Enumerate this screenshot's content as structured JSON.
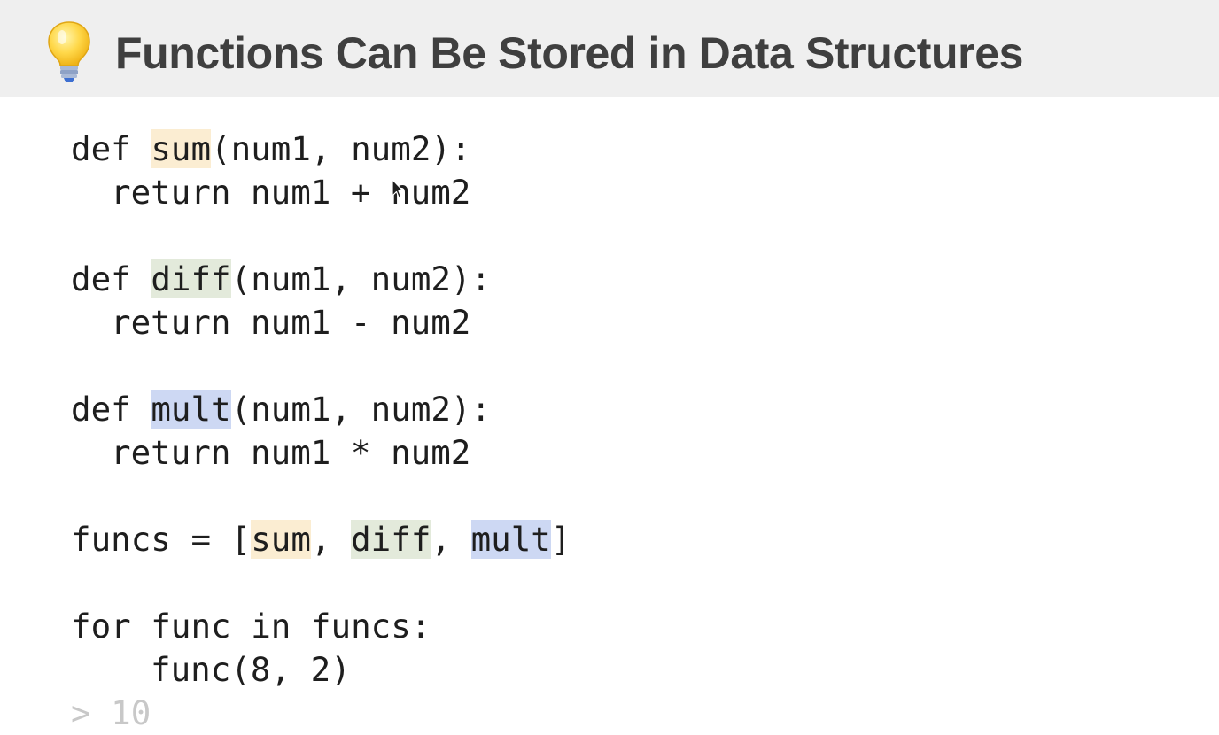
{
  "slide": {
    "icon": "lightbulb-icon",
    "title": "Functions Can Be Stored in Data Structures"
  },
  "code": {
    "sum_def": {
      "kw": "def ",
      "name": "sum",
      "params": "(num1, num2):"
    },
    "sum_return": "return num1 + num2",
    "diff_def": {
      "kw": "def ",
      "name": "diff",
      "params": "(num1, num2):"
    },
    "diff_return": "return num1 - num2",
    "mult_def": {
      "kw": "def ",
      "name": "mult",
      "params": "(num1, num2):"
    },
    "mult_return": "return num1 * num2",
    "funcs_line": {
      "prefix": "funcs = [",
      "items": [
        "sum",
        "diff",
        "mult"
      ],
      "sep": ", ",
      "suffix": "]"
    },
    "for_line": "for func in funcs:",
    "call_line": "func(8, 2)",
    "output": "> 10"
  },
  "colors": {
    "header_bg": "#efefef",
    "title": "#3f3f3f",
    "highlight_sum": "#fbedd2",
    "highlight_diff": "#e3eadb",
    "highlight_mult": "#cdd8f3",
    "output_text": "#c8c8c8"
  }
}
